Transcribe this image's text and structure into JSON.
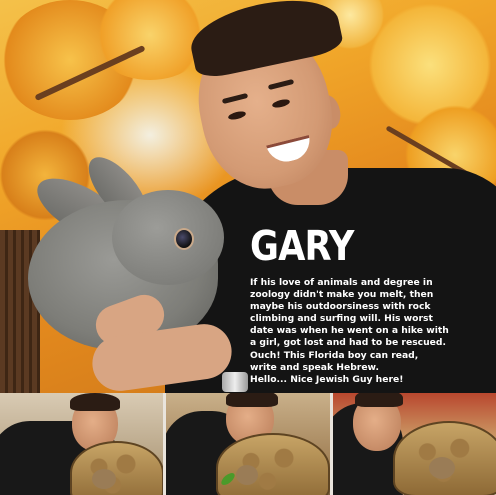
{
  "profile": {
    "name": "GARY",
    "bio_lines": [
      "If his love of animals and degree in",
      "zoology didn't make you melt, then",
      "maybe his outdoorsiness with rock",
      "climbing and surfing will. His worst",
      "date was when he went on a hike with",
      "a girl, got lost and had to be rescued.",
      "Ouch! This Florida boy can read,",
      "write and speak Hebrew.",
      "Hello... Nice Jewish Guy here!"
    ]
  },
  "colors": {
    "text": "#ffffff",
    "shirt": "#141414",
    "blossom": "#f2a72a"
  },
  "photos": {
    "main": "man-holding-rabbit-photo",
    "thumbnails": [
      "man-with-tortoise-photo-1",
      "man-with-tortoise-photo-2",
      "man-with-tortoise-photo-3"
    ]
  }
}
